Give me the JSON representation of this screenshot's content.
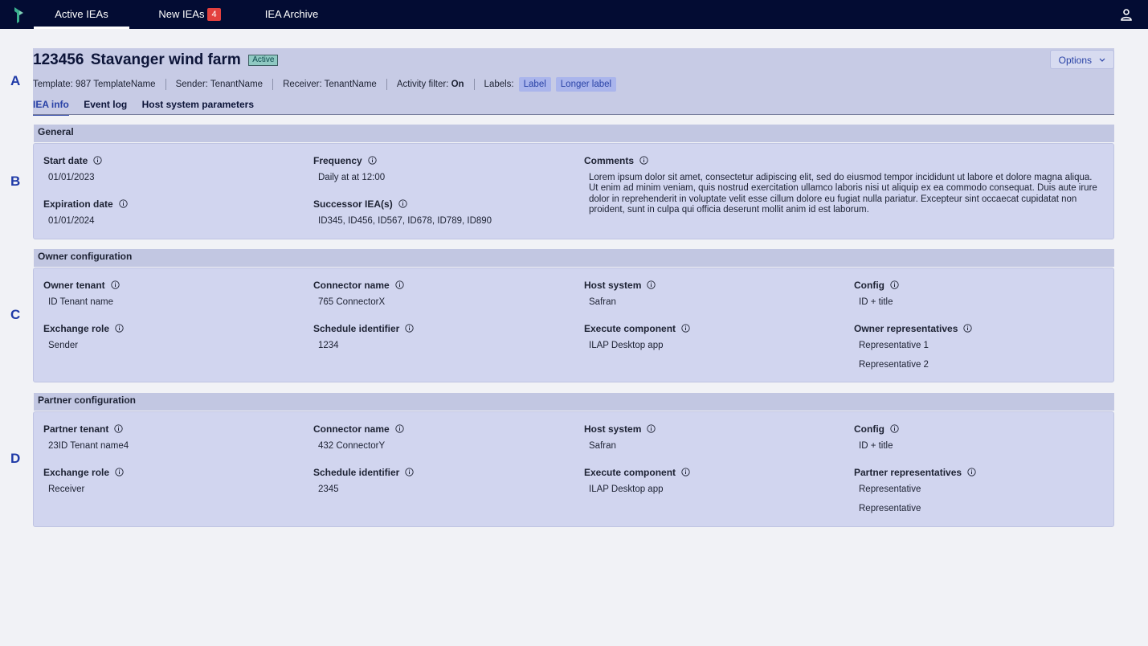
{
  "nav": {
    "tabs": [
      {
        "label": "Active IEAs"
      },
      {
        "label": "New IEAs",
        "badge": "4"
      },
      {
        "label": "IEA Archive"
      }
    ]
  },
  "side_letters": [
    "A",
    "B",
    "C",
    "D"
  ],
  "header": {
    "id": "123456",
    "name": "Stavanger wind farm",
    "status": "Active",
    "options_label": "Options",
    "meta": {
      "template": "Template: 987 TemplateName",
      "sender": "Sender: TenantName",
      "receiver": "Receiver: TenantName",
      "activity_prefix": "Activity filter: ",
      "activity_value": "On",
      "labels_prefix": "Labels:",
      "labels": [
        "Label",
        "Longer label"
      ]
    },
    "tabs": [
      "IEA info",
      "Event log",
      "Host system parameters"
    ]
  },
  "general": {
    "title": "General",
    "start_date_label": "Start date",
    "start_date": "01/01/2023",
    "expiration_date_label": "Expiration date",
    "expiration_date": "01/01/2024",
    "frequency_label": "Frequency",
    "frequency": "Daily at at 12:00",
    "successor_label": "Successor IEA(s)",
    "successor": "ID345, ID456, ID567, ID678, ID789, ID890",
    "comments_label": "Comments",
    "comments": "Lorem ipsum dolor sit amet, consectetur adipiscing elit, sed do eiusmod tempor incididunt ut labore et dolore magna aliqua. Ut enim ad minim veniam, quis nostrud exercitation ullamco laboris nisi ut aliquip ex ea commodo consequat. Duis aute irure dolor in reprehenderit in voluptate velit esse cillum dolore eu fugiat nulla pariatur. Excepteur sint occaecat cupidatat non proident, sunt in culpa qui officia deserunt mollit anim id est laborum."
  },
  "owner": {
    "title": "Owner configuration",
    "tenant_label": "Owner tenant",
    "tenant": "ID Tenant name",
    "role_label": "Exchange role",
    "role": "Sender",
    "connector_label": "Connector name",
    "connector": "765 ConnectorX",
    "schedule_label": "Schedule identifier",
    "schedule": "1234",
    "host_label": "Host system",
    "host": "Safran",
    "execute_label": "Execute component",
    "execute": "ILAP Desktop app",
    "config_label": "Config",
    "config": "ID + title",
    "reps_label": "Owner representatives",
    "reps": [
      "Representative 1",
      "Representative 2"
    ]
  },
  "partner": {
    "title": "Partner configuration",
    "tenant_label": "Partner tenant",
    "tenant": "23ID Tenant name4",
    "role_label": "Exchange role",
    "role": "Receiver",
    "connector_label": "Connector name",
    "connector": "432 ConnectorY",
    "schedule_label": "Schedule identifier",
    "schedule": "2345",
    "host_label": "Host system",
    "host": "Safran",
    "execute_label": "Execute component",
    "execute": "ILAP Desktop app",
    "config_label": "Config",
    "config": "ID + title",
    "reps_label": "Partner representatives",
    "reps": [
      "Representative",
      "Representative"
    ]
  }
}
